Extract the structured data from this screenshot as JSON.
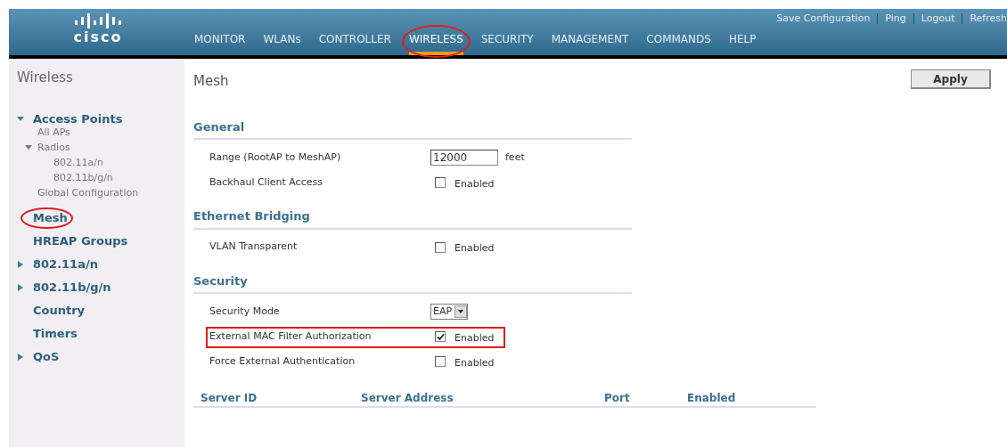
{
  "header": {
    "logo": "cisco",
    "top_links": [
      "Save Configuration",
      "Ping",
      "Logout",
      "Refresh"
    ],
    "nav": [
      {
        "label": "MONITOR",
        "selected": false,
        "highlighted": false
      },
      {
        "label": "WLANs",
        "selected": false,
        "highlighted": false
      },
      {
        "label": "CONTROLLER",
        "selected": false,
        "highlighted": false
      },
      {
        "label": "WIRELESS",
        "selected": true,
        "highlighted": true
      },
      {
        "label": "SECURITY",
        "selected": false,
        "highlighted": false
      },
      {
        "label": "MANAGEMENT",
        "selected": false,
        "highlighted": false
      },
      {
        "label": "COMMANDS",
        "selected": false,
        "highlighted": false
      },
      {
        "label": "HELP",
        "selected": false,
        "highlighted": false
      }
    ]
  },
  "sidebar": {
    "title": "Wireless",
    "items": [
      {
        "label": "Access Points",
        "expanded": true,
        "highlighted": false,
        "children": [
          {
            "label": "All APs",
            "highlighted": false
          },
          {
            "label": "Radios",
            "expanded": true,
            "highlighted": false,
            "children": [
              {
                "label": "802.11a/n",
                "highlighted": false
              },
              {
                "label": "802.11b/g/n",
                "highlighted": false
              }
            ]
          },
          {
            "label": "Global Configuration",
            "highlighted": false
          }
        ]
      },
      {
        "label": "Mesh",
        "highlighted": true
      },
      {
        "label": "HREAP Groups",
        "highlighted": false
      },
      {
        "label": "802.11a/n",
        "expanded": false,
        "highlighted": false
      },
      {
        "label": "802.11b/g/n",
        "expanded": false,
        "highlighted": false
      },
      {
        "label": "Country",
        "highlighted": false
      },
      {
        "label": "Timers",
        "highlighted": false
      },
      {
        "label": "QoS",
        "expanded": false,
        "highlighted": false
      }
    ]
  },
  "page": {
    "title": "Mesh",
    "apply_button": "Apply"
  },
  "sections": [
    {
      "title": "General",
      "rows": [
        {
          "kind": "text",
          "label": "Range (RootAP to MeshAP)",
          "value": "12000",
          "unit": "feet",
          "highlighted": false
        },
        {
          "kind": "checkbox",
          "label": "Backhaul Client Access",
          "checked": false,
          "option": "Enabled",
          "highlighted": false
        }
      ]
    },
    {
      "title": "Ethernet Bridging",
      "rows": [
        {
          "kind": "checkbox",
          "label": "VLAN Transparent",
          "checked": false,
          "option": "Enabled",
          "highlighted": false
        }
      ]
    },
    {
      "title": "Security",
      "rows": [
        {
          "kind": "select",
          "label": "Security Mode",
          "value": "EAP",
          "highlighted": false
        },
        {
          "kind": "checkbox",
          "label": "External MAC Filter Authorization",
          "checked": true,
          "option": "Enabled",
          "highlighted": true
        },
        {
          "kind": "checkbox",
          "label": "Force External Authentication",
          "checked": false,
          "option": "Enabled",
          "highlighted": false
        }
      ]
    }
  ],
  "server_table": {
    "columns": [
      "Server ID",
      "Server Address",
      "Port",
      "Enabled"
    ]
  }
}
